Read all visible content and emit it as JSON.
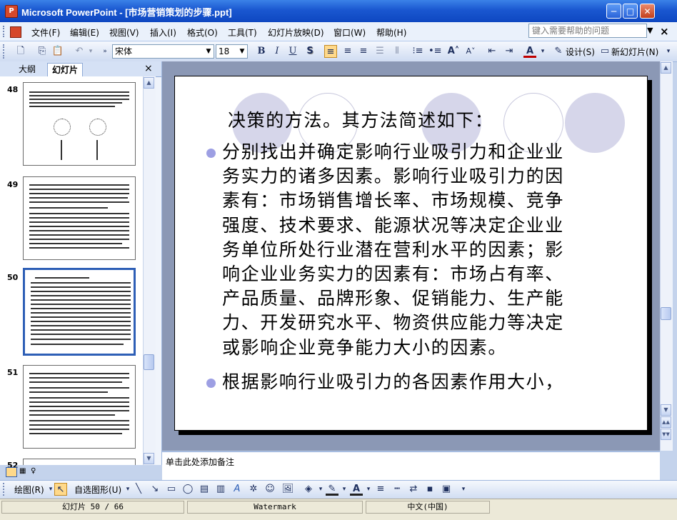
{
  "window": {
    "title": "Microsoft PowerPoint - [市场营销策划的步骤.ppt]",
    "app_icon_letter": "P",
    "minimize": "─",
    "maximize": "□",
    "close": "✕"
  },
  "menu": {
    "items": [
      "文件(F)",
      "编辑(E)",
      "视图(V)",
      "插入(I)",
      "格式(O)",
      "工具(T)",
      "幻灯片放映(D)",
      "窗口(W)",
      "帮助(H)"
    ],
    "help_placeholder": "键入需要帮助的问题",
    "close_doc": "×"
  },
  "toolbar": {
    "font_name": "宋体",
    "font_size": "18",
    "bold": "B",
    "italic": "I",
    "underline": "U",
    "shadow": "S",
    "design_label": "设计(S)",
    "new_slide_label": "新幻灯片(N)",
    "increase_font": "A˄",
    "decrease_font": "A˅",
    "font_color": "A"
  },
  "outline_pane": {
    "tabs": [
      "大纲",
      "幻灯片"
    ],
    "active_tab": "幻灯片",
    "close": "×",
    "thumbnails": [
      {
        "number": "48"
      },
      {
        "number": "49"
      },
      {
        "number": "50",
        "selected": true
      },
      {
        "number": "51"
      },
      {
        "number": "52"
      }
    ]
  },
  "slide": {
    "heading": "决策的方法。其方法简述如下：",
    "bullets": [
      {
        "lines": [
          "分别找出并确定影响行业吸引力和企业业",
          "务实力的诸多因素。影响行业吸引力的因",
          "素有：市场销售增长率、市场规模、竞争",
          "强度、技术要求、能源状况等决定企业业",
          "务单位所处行业潜在营利水平的因素；影",
          "响企业业务实力的因素有：市场占有率、",
          "产品质量、品牌形象、促销能力、生产能",
          "力、开发研究水平、物资供应能力等决定",
          "或影响企业竞争能力大小的因素。"
        ]
      },
      {
        "lines": [
          "根据影响行业吸引力的各因素作用大小，"
        ]
      }
    ],
    "bullet_color": "#9d9fe3",
    "circle_color": "#d6d6ea"
  },
  "notes": {
    "placeholder": "单击此处添加备注"
  },
  "drawing_toolbar": {
    "draw_label": "绘图(R)",
    "autoshapes_label": "自选图形(U)"
  },
  "status": {
    "slide": "幻灯片 50 / 66",
    "design": "Watermark",
    "language": "中文(中国)"
  }
}
